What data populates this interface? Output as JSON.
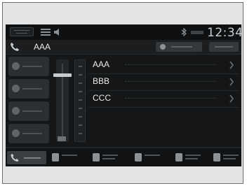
{
  "status_bar": {
    "clock": "12:34",
    "icons": [
      "home-icon",
      "menu-icon",
      "speaker-icon",
      "bluetooth-icon",
      "signal-icon"
    ]
  },
  "header": {
    "title": "AAA",
    "icon": "phone-icon"
  },
  "contacts": [
    {
      "name": "AAA"
    },
    {
      "name": "BBB"
    },
    {
      "name": "CCC"
    }
  ],
  "colors": {
    "screen_background": "#141617",
    "frame_background": "#e3e4e5",
    "text": "#e9ebec"
  }
}
